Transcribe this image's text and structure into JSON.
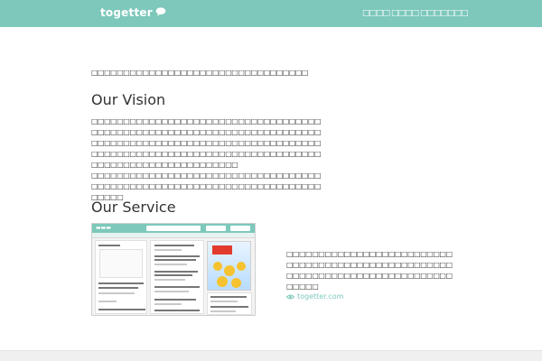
{
  "header": {
    "logo_text": "togetter",
    "nav": [
      {
        "label": "□□□□"
      },
      {
        "label": "□□□□"
      },
      {
        "label": "□□□□□□□"
      }
    ]
  },
  "intro": {
    "text": "□□□□□□□□□□□□□□□□□□□□□□□□□□□□□□□□□□"
  },
  "vision": {
    "heading": "Our Vision",
    "paragraphs": [
      "□□□□□□□□□□□□□□□□□□□□□□□□□□□□□□□□□□□□□□□□□□□□□□□□□□□□□□□□□□□□□□□□□□□□□□□□□□□□□□□□□□□□□□□□□□□□□□□□□□□□□□□□□□□□□□□□□□□□□□□□□□□□□□□□□□□□□□□□□□□□□□□□□□□□□□□□□□□□□□□□□□□□□□□",
      "□□□□□□□□□□□□□□□□□□□□□□□□□□□□□□□□□□□□□□□□□□□□□□□□□□□□□□□□□□□□□□□□□□□□□□□□□□□□□"
    ]
  },
  "service": {
    "heading": "Our Service",
    "description": "□□□□□□□□□□□□□□□□□□□□□□□□□□□□□□□□□□□□□□□□□□□□□□□□□□□□□□□□□□□□□□□□□□□□□□□□□□□□□□□□□□□",
    "link": {
      "label": "togetter.com",
      "icon": "eye-icon"
    }
  },
  "colors": {
    "brand": "#7dc8bb",
    "text": "#333333",
    "footer": "#f0f0f0"
  }
}
